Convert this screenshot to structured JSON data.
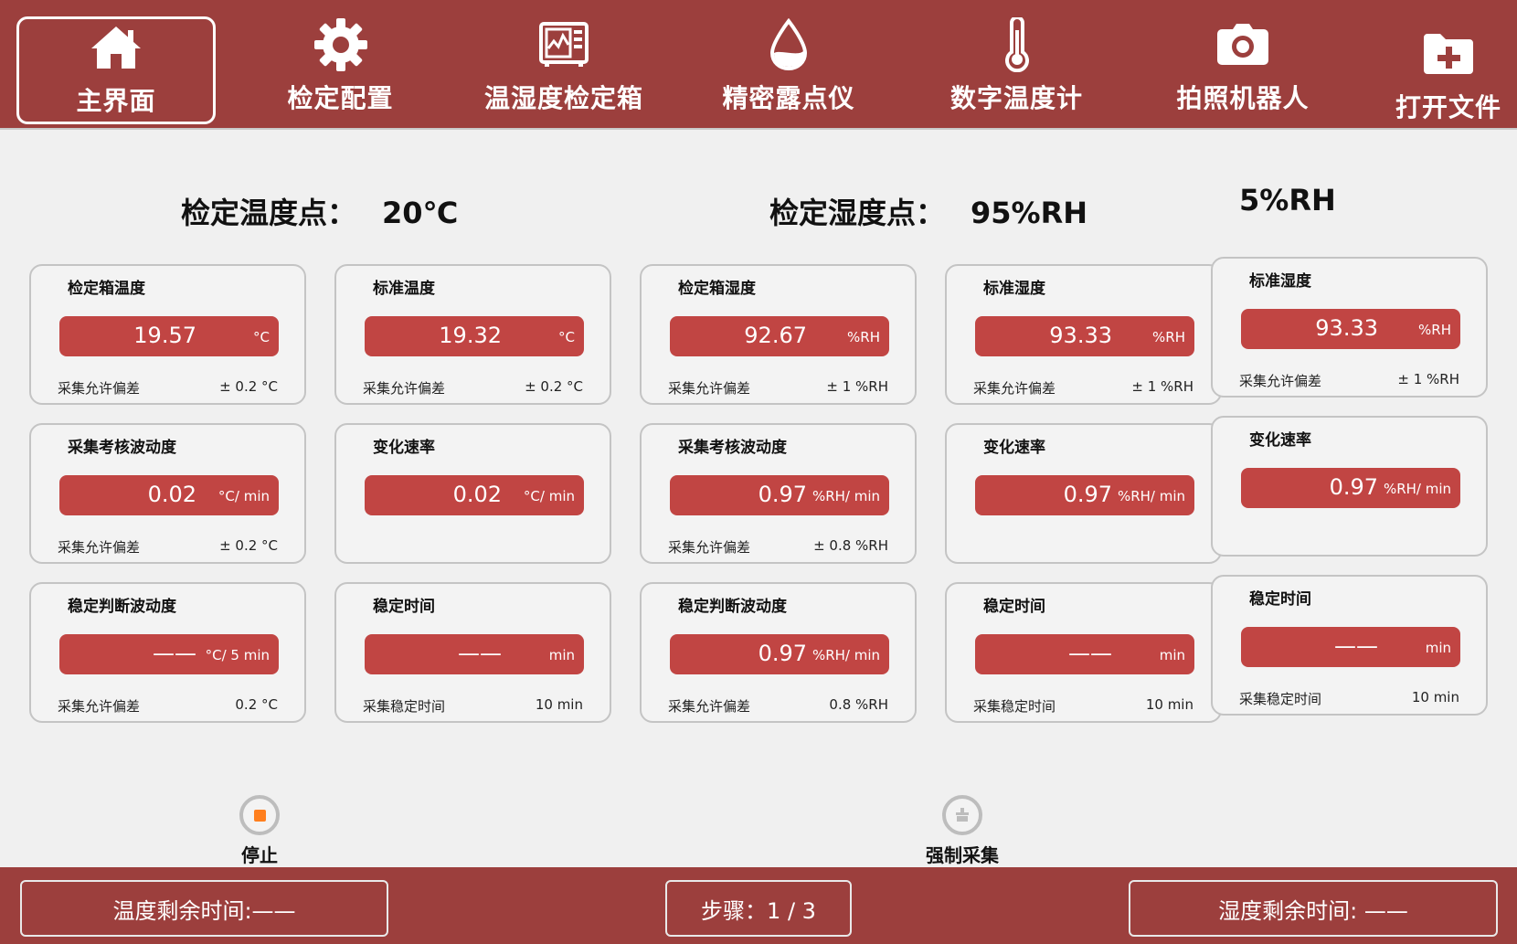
{
  "nav": {
    "items": [
      {
        "label": "主界面",
        "icon": "home-icon",
        "active": true
      },
      {
        "label": "检定配置",
        "icon": "gear-icon"
      },
      {
        "label": "温湿度检定箱",
        "icon": "chamber-icon"
      },
      {
        "label": "精密露点仪",
        "icon": "droplet-icon"
      },
      {
        "label": "数字温度计",
        "icon": "thermometer-icon"
      },
      {
        "label": "拍照机器人",
        "icon": "camera-icon"
      },
      {
        "label": "打开文件",
        "icon": "folder-plus-icon"
      }
    ]
  },
  "headings": {
    "temp_label": "检定温度点：",
    "temp_value": "20℃",
    "hum_label": "检定湿度点：",
    "hum_value": "95%RH",
    "hum2_value": "5%RH"
  },
  "cards": {
    "c1": {
      "title": "检定箱温度",
      "value": "19.57",
      "unit": "°C",
      "foot_label": "采集允许偏差",
      "foot_value": "± 0.2 °C"
    },
    "c2": {
      "title": "标准温度",
      "value": "19.32",
      "unit": "°C",
      "foot_label": "采集允许偏差",
      "foot_value": "± 0.2 °C"
    },
    "c3": {
      "title": "检定箱湿度",
      "value": "92.67",
      "unit": "%RH",
      "foot_label": "采集允许偏差",
      "foot_value": "± 1 %RH"
    },
    "c4": {
      "title": "标准湿度",
      "value": "93.33",
      "unit": "%RH",
      "foot_label": "采集允许偏差",
      "foot_value": "± 1 %RH"
    },
    "c5": {
      "title": "标准湿度",
      "value": "93.33",
      "unit": "%RH",
      "foot_label": "采集允许偏差",
      "foot_value": "± 1 %RH"
    },
    "c6": {
      "title": "采集考核波动度",
      "value": "0.02",
      "unit": "°C/ min",
      "foot_label": "采集允许偏差",
      "foot_value": "± 0.2 °C"
    },
    "c7": {
      "title": "变化速率",
      "value": "0.02",
      "unit": "°C/ min",
      "foot_label": "",
      "foot_value": ""
    },
    "c8": {
      "title": "采集考核波动度",
      "value": "0.97",
      "unit": "%RH/ min",
      "foot_label": "采集允许偏差",
      "foot_value": "± 0.8 %RH"
    },
    "c9": {
      "title": "变化速率",
      "value": "0.97",
      "unit": "%RH/ min",
      "foot_label": "",
      "foot_value": ""
    },
    "c10": {
      "title": "变化速率",
      "value": "0.97",
      "unit": "%RH/ min",
      "foot_label": "",
      "foot_value": ""
    },
    "c11": {
      "title": "稳定判断波动度",
      "value": "——",
      "unit": "°C/ 5 min",
      "foot_label": "采集允许偏差",
      "foot_value": "0.2 °C"
    },
    "c12": {
      "title": "稳定时间",
      "value": "——",
      "unit": "min",
      "foot_label": "采集稳定时间",
      "foot_value": "10 min"
    },
    "c13": {
      "title": "稳定判断波动度",
      "value": "0.97",
      "unit": "%RH/ min",
      "foot_label": "采集允许偏差",
      "foot_value": "0.8 %RH"
    },
    "c14": {
      "title": "稳定时间",
      "value": "——",
      "unit": "min",
      "foot_label": "采集稳定时间",
      "foot_value": "10 min"
    },
    "c15": {
      "title": "稳定时间",
      "value": "——",
      "unit": "min",
      "foot_label": "采集稳定时间",
      "foot_value": "10 min"
    }
  },
  "actions": {
    "stop_label": "停止",
    "force_label": "强制采集"
  },
  "bottom": {
    "temp_remaining": "温度剩余时间:——",
    "step": "步骤：1 / 3",
    "hum_remaining": "湿度剩余时间: ——"
  },
  "colors": {
    "bar": "#9c3f3d",
    "value_box": "#c14543",
    "stop_dot": "#ff7f1e"
  }
}
